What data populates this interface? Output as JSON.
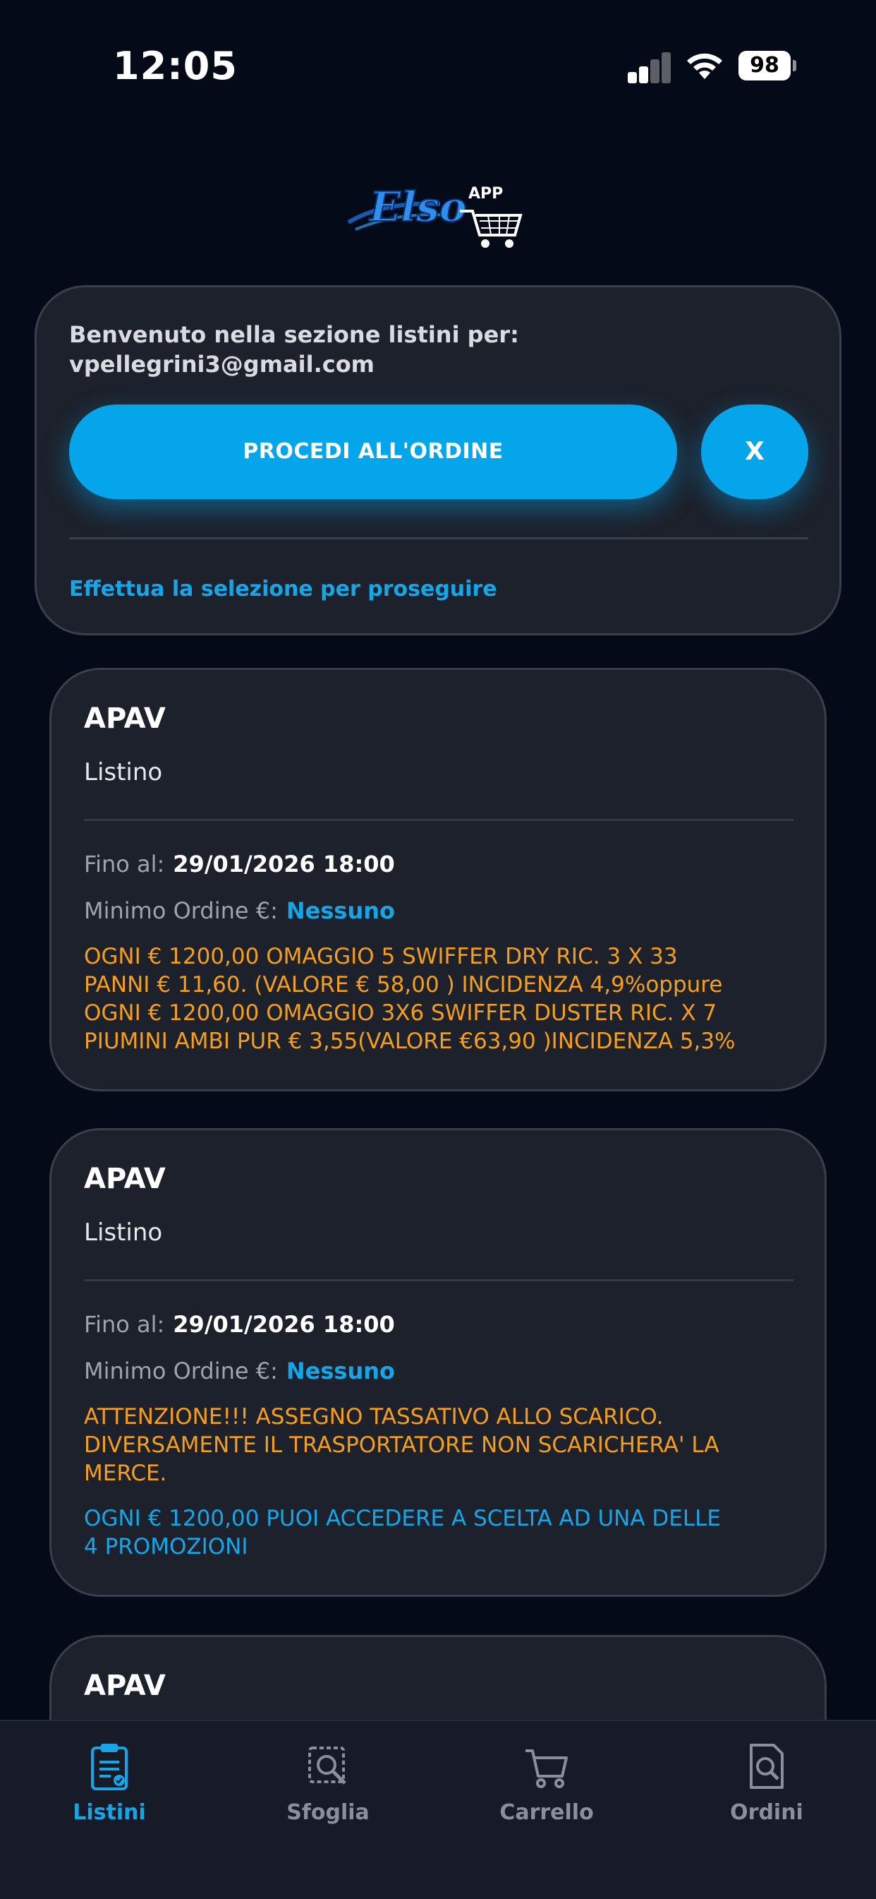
{
  "status_bar": {
    "time": "12:05",
    "battery": "98"
  },
  "welcome": {
    "line1": "Benvenuto nella sezione listini per:",
    "email": "vpellegrini3@gmail.com",
    "proceed_label": "PROCEDI ALL'ORDINE",
    "close_label": "X",
    "hint": "Effettua la selezione per proseguire"
  },
  "cards": [
    {
      "title": "APAV",
      "subtitle": "Listino",
      "until_label": "Fino al:",
      "until_value": "29/01/2026 18:00",
      "min_label": "Minimo Ordine €:",
      "min_value": "Nessuno",
      "note_orange": "OGNI € 1200,00   OMAGGIO 5 SWIFFER DRY RIC. 3 X 33\nPANNI  € 11,60. (VALORE € 58,00 )  INCIDENZA 4,9%oppure\nOGNI € 1200,00    OMAGGIO 3X6 SWIFFER DUSTER RIC. X 7\nPIUMINI AMBI PUR € 3,55(VALORE €63,90 )INCIDENZA 5,3%"
    },
    {
      "title": "APAV",
      "subtitle": "Listino",
      "until_label": "Fino al:",
      "until_value": "29/01/2026 18:00",
      "min_label": "Minimo Ordine €:",
      "min_value": "Nessuno",
      "note_orange": "ATTENZIONE!!! ASSEGNO TASSATIVO ALLO SCARICO.\nDIVERSAMENTE IL TRASPORTATORE NON SCARICHERA' LA\nMERCE.",
      "note_blue": "OGNI € 1200,00 PUOI ACCEDERE A SCELTA AD UNA DELLE\n4 PROMOZIONI"
    },
    {
      "title": "APAV"
    }
  ],
  "tabs": [
    {
      "label": "Listini",
      "icon": "clipboard-icon",
      "active": true
    },
    {
      "label": "Sfoglia",
      "icon": "browse-icon",
      "active": false
    },
    {
      "label": "Carrello",
      "icon": "cart-icon",
      "active": false
    },
    {
      "label": "Ordini",
      "icon": "orders-search-icon",
      "active": false
    }
  ],
  "colors": {
    "accent": "#04a5ea",
    "orange": "#f59e1b",
    "background": "#040a17",
    "card": "#1d212b"
  }
}
